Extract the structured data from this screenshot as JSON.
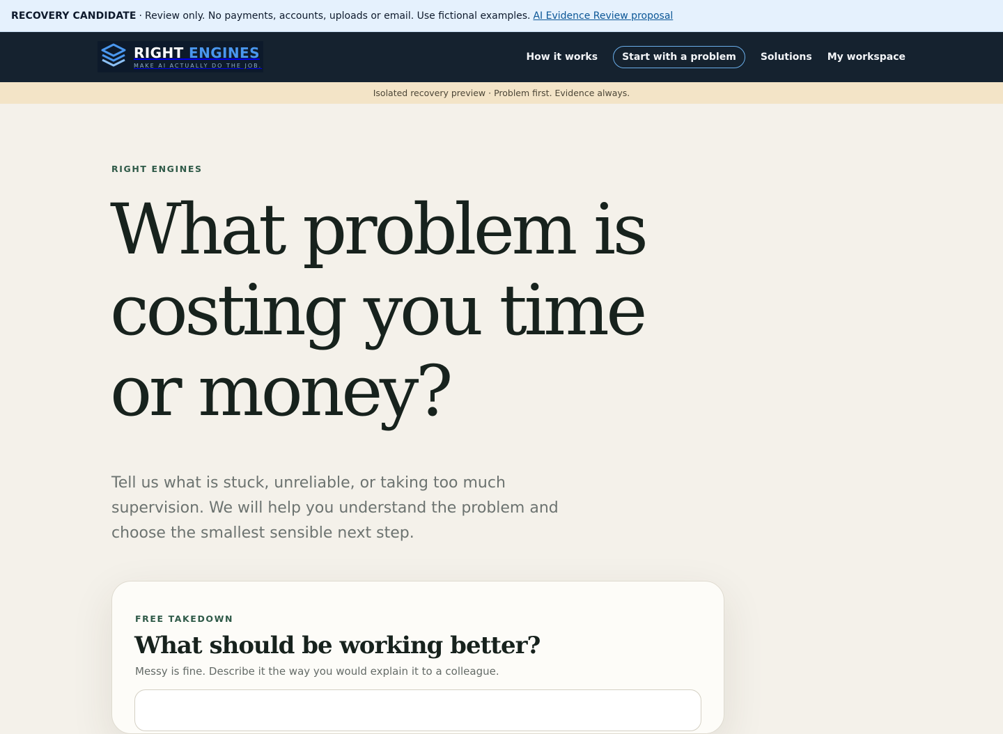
{
  "banner": {
    "label": "RECOVERY CANDIDATE",
    "separator": "·",
    "message": "Review only. No payments, accounts, uploads or email. Use fictional examples.",
    "link_text": "AI Evidence Review proposal"
  },
  "nav": {
    "logo": {
      "title_main": "RIGHT",
      "title_accent": "ENGINES",
      "tagline": "MAKE AI ACTUALLY DO THE JOB."
    },
    "links": [
      {
        "label": "How it works"
      },
      {
        "label": "Start with a problem"
      },
      {
        "label": "Solutions"
      },
      {
        "label": "My workspace"
      }
    ]
  },
  "preview_strip": {
    "text": "Isolated recovery preview · Problem first. Evidence always."
  },
  "hero": {
    "eyebrow": "RIGHT ENGINES",
    "title": "What problem is costing you time or money?",
    "subtitle": "Tell us what is stuck, unreliable, or taking too much supervision. We will help you understand the problem and choose the smallest sensible next step."
  },
  "card": {
    "eyebrow": "FREE TAKEDOWN",
    "title": "What should be working better?",
    "description": "Messy is fine. Describe it the way you would explain it to a colleague.",
    "input_value": ""
  },
  "colors": {
    "page_bg": "#f4f1ea",
    "nav_bg": "#15222f",
    "banner_bg": "#e5f1fd",
    "strip_bg": "#f3e4c7",
    "accent_blue": "#4a97ee",
    "eyebrow_green": "#2f5a48"
  }
}
